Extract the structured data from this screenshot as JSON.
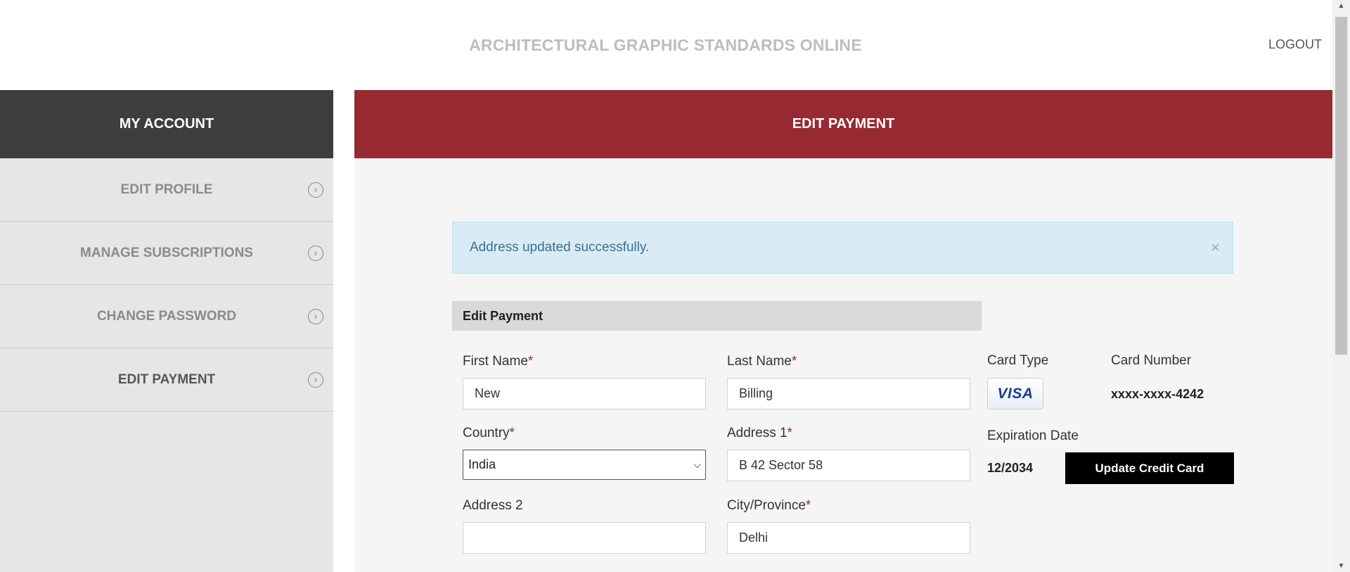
{
  "header": {
    "site_title": "ARCHITECTURAL GRAPHIC STANDARDS ONLINE",
    "logout_label": "LOGOUT"
  },
  "sidebar": {
    "title": "MY ACCOUNT",
    "items": [
      {
        "label": "EDIT PROFILE",
        "icon": "chevron-right-circle-icon"
      },
      {
        "label": "MANAGE SUBSCRIPTIONS",
        "icon": "chevron-right-circle-icon"
      },
      {
        "label": "CHANGE PASSWORD",
        "icon": "chevron-right-circle-icon"
      },
      {
        "label": "EDIT PAYMENT",
        "icon": "chevron-right-circle-icon",
        "active": true
      }
    ]
  },
  "main": {
    "title": "EDIT PAYMENT",
    "alert": {
      "message": "Address updated successfully.",
      "close_label": "×"
    },
    "form": {
      "heading": "Edit Payment",
      "first_name": {
        "label": "First Name",
        "value": "New"
      },
      "last_name": {
        "label": "Last Name",
        "value": "Billing"
      },
      "country": {
        "label": "Country",
        "value": "India"
      },
      "address1": {
        "label": "Address 1",
        "value": "B 42 Sector 58"
      },
      "address2": {
        "label": "Address 2",
        "value": ""
      },
      "city": {
        "label": "City/Province",
        "value": "Delhi"
      },
      "required_marker": "*"
    },
    "card": {
      "type_label": "Card Type",
      "type_value": "VISA",
      "number_label": "Card Number",
      "number_value": "xxxx-xxxx-4242",
      "expiration_label": "Expiration Date",
      "expiration_value": "12/2034",
      "update_button": "Update Credit Card"
    }
  },
  "colors": {
    "brand_red": "#962931",
    "sidebar_dark": "#3e3e3e",
    "alert_bg": "#d9ecf5"
  }
}
